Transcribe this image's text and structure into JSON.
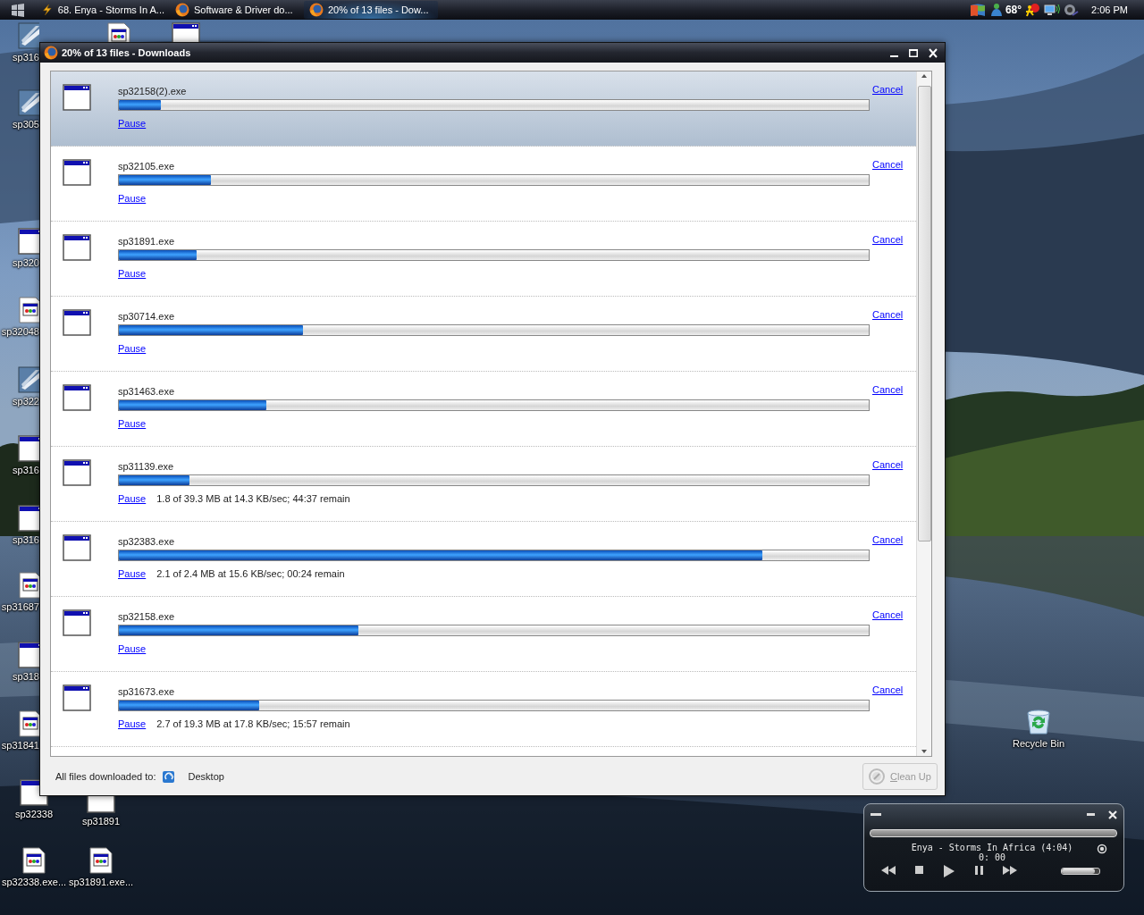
{
  "taskbar": {
    "start": {
      "kind": "start"
    },
    "tasks": [
      {
        "label": "68. Enya - Storms In A...",
        "kind": "player",
        "selected": false
      },
      {
        "label": "Software & Driver do...",
        "kind": "browser",
        "selected": false
      },
      {
        "label": "20% of 13 files - Dow...",
        "kind": "browser",
        "selected": true
      }
    ],
    "tray": {
      "temperature": "68°",
      "clock": "2:06 PM"
    }
  },
  "desktop_icons": [
    {
      "label": "sp316",
      "kind": "setup"
    },
    {
      "kind": "document"
    },
    {
      "kind": "window"
    },
    {
      "label": "sp305",
      "kind": "setup"
    },
    {
      "label": "sp320",
      "kind": "window"
    },
    {
      "label": "sp32048",
      "kind": "document"
    },
    {
      "label": "sp322",
      "kind": "setup"
    },
    {
      "label": "sp316",
      "kind": "window"
    },
    {
      "label": "sp316",
      "kind": "window"
    },
    {
      "label": "sp31687",
      "kind": "document"
    },
    {
      "label": "sp318",
      "kind": "window"
    },
    {
      "label": "sp31841",
      "kind": "document"
    },
    {
      "label": "sp32338",
      "kind": "window"
    },
    {
      "label": "sp31891",
      "kind": "window"
    },
    {
      "label": "sp32338.exe...",
      "kind": "document"
    },
    {
      "label": "sp31891.exe...",
      "kind": "document"
    },
    {
      "label": "Recycle Bin",
      "kind": "recycle"
    }
  ],
  "downloads_window": {
    "title": "20% of 13 files - Downloads",
    "downloads": [
      {
        "name": "sp32158(2).exe",
        "level": 0.056,
        "pause": "Pause",
        "cancel": "Cancel",
        "selected": true
      },
      {
        "name": "sp32105.exe",
        "level": 0.123,
        "pause": "Pause",
        "cancel": "Cancel",
        "selected": false
      },
      {
        "name": "sp31891.exe",
        "level": 0.104,
        "pause": "Pause",
        "cancel": "Cancel",
        "selected": false
      },
      {
        "name": "sp30714.exe",
        "level": 0.245,
        "pause": "Pause",
        "cancel": "Cancel",
        "selected": false
      },
      {
        "name": "sp31463.exe",
        "level": 0.197,
        "pause": "Pause",
        "cancel": "Cancel",
        "selected": false
      },
      {
        "name": "sp31139.exe",
        "level": 0.094,
        "pause": "Pause",
        "cancel": "Cancel",
        "status": "1.8 of 39.3 MB at 14.3 KB/sec; 44:37 remain",
        "selected": false
      },
      {
        "name": "sp32383.exe",
        "level": 0.858,
        "pause": "Pause",
        "cancel": "Cancel",
        "status": "2.1 of 2.4 MB at 15.6 KB/sec; 00:24 remain",
        "selected": false
      },
      {
        "name": "sp32158.exe",
        "level": 0.32,
        "pause": "Pause",
        "cancel": "Cancel",
        "selected": false
      },
      {
        "name": "sp31673.exe",
        "level": 0.187,
        "pause": "Pause",
        "cancel": "Cancel",
        "status": "2.7 of 19.3 MB at 17.8 KB/sec; 15:57 remain",
        "selected": false
      }
    ],
    "footer": {
      "label": "All files downloaded to:",
      "folder": "Desktop",
      "clean_up": {
        "label": "Clean Up",
        "disabled": true
      }
    }
  },
  "media_player": {
    "track": "Enya - Storms In Africa (4:04)",
    "time": "0: 00",
    "volume": {
      "level": 0.88
    }
  }
}
